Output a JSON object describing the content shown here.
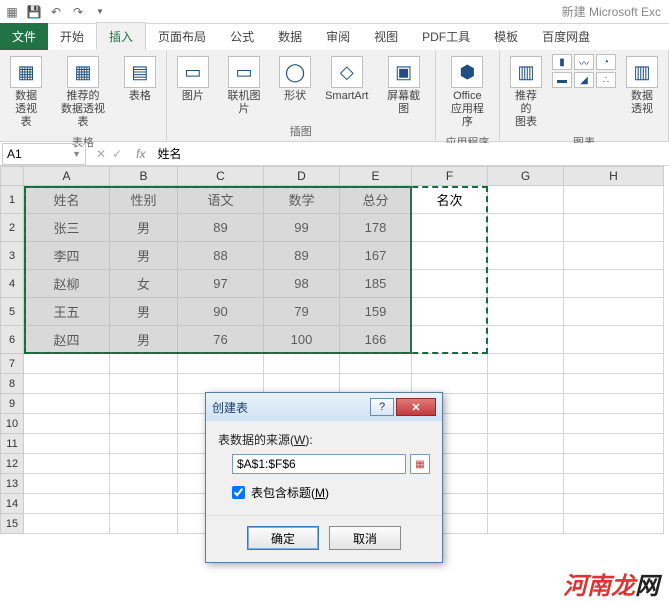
{
  "app_title": "新建 Microsoft Exc",
  "qat": [
    "save-icon",
    "undo-icon",
    "redo-icon"
  ],
  "tabs": {
    "file": "文件",
    "home": "开始",
    "insert": "插入",
    "layout": "页面布局",
    "formulas": "公式",
    "data": "数据",
    "review": "审阅",
    "view": "视图",
    "pdf": "PDF工具",
    "template": "模板",
    "baidu": "百度网盘"
  },
  "ribbon": {
    "groups": {
      "tables": {
        "label": "表格",
        "pivot": "数据\n透视表",
        "rec_pivot": "推荐的\n数据透视表",
        "table": "表格"
      },
      "illus": {
        "label": "插图",
        "pic": "图片",
        "online_pic": "联机图片",
        "shapes": "形状",
        "smartart": "SmartArt",
        "screenshot": "屏幕截图"
      },
      "apps": {
        "label": "应用程序",
        "office_apps": "Office\n应用程序"
      },
      "charts": {
        "label": "图表",
        "rec_chart": "推荐的\n图表",
        "pivot_chart": "数据透视"
      }
    }
  },
  "name_box": "A1",
  "formula": "姓名",
  "columns": [
    "A",
    "B",
    "C",
    "D",
    "E",
    "F",
    "G",
    "H"
  ],
  "row_numbers": [
    1,
    2,
    3,
    4,
    5,
    6,
    7,
    8,
    9,
    10,
    11,
    12,
    13,
    14,
    15
  ],
  "chart_data": {
    "type": "table",
    "headers": [
      "姓名",
      "性别",
      "语文",
      "数学",
      "总分",
      "名次"
    ],
    "rows": [
      [
        "张三",
        "男",
        89,
        99,
        178,
        ""
      ],
      [
        "李四",
        "男",
        88,
        89,
        167,
        ""
      ],
      [
        "赵柳",
        "女",
        97,
        98,
        185,
        ""
      ],
      [
        "王五",
        "男",
        90,
        79,
        159,
        ""
      ],
      [
        "赵四",
        "男",
        76,
        100,
        166,
        ""
      ]
    ]
  },
  "dialog": {
    "title": "创建表",
    "source_label_pre": "表数据的来源(",
    "source_label_u": "W",
    "source_label_post": "):",
    "source_value": "$A$1:$F$6",
    "headers_label_pre": "表包含标题(",
    "headers_label_u": "M",
    "headers_label_post": ")",
    "ok": "确定",
    "cancel": "取消"
  },
  "watermark": {
    "red": "河南龙",
    "black": "网"
  }
}
